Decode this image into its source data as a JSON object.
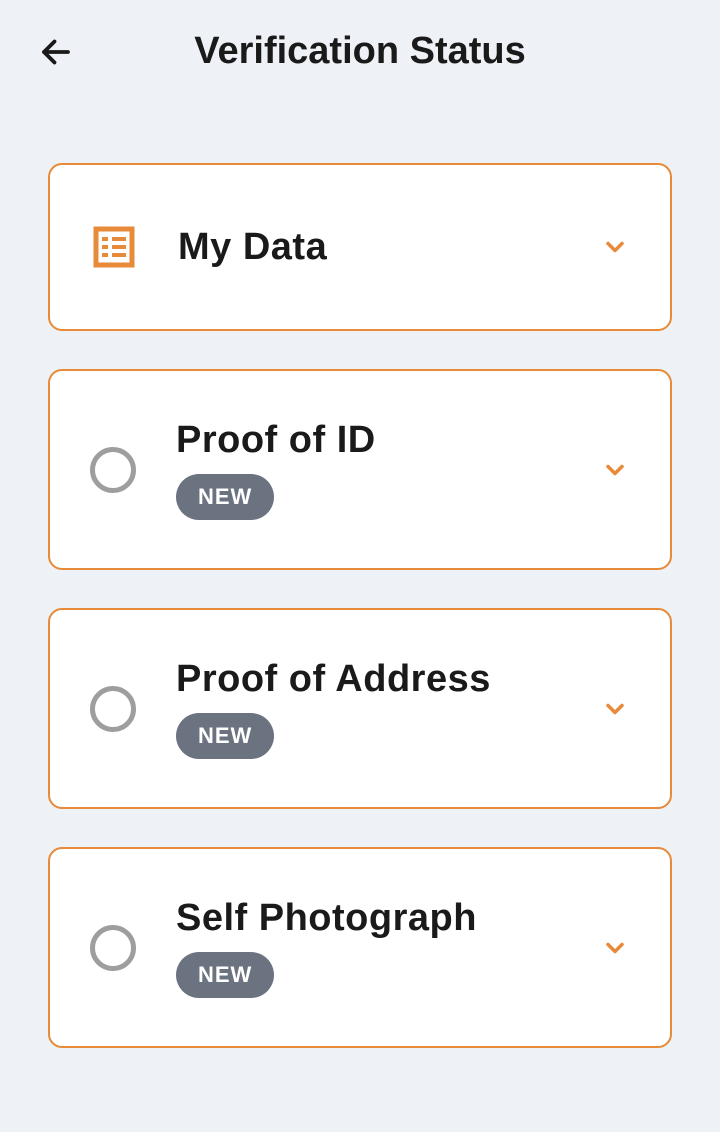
{
  "header": {
    "title": "Verification Status"
  },
  "cards": {
    "myData": {
      "title": "My Data"
    },
    "proofOfId": {
      "title": "Proof of ID",
      "badge": "NEW"
    },
    "proofOfAddress": {
      "title": "Proof of Address",
      "badge": "NEW"
    },
    "selfPhotograph": {
      "title": "Self Photograph",
      "badge": "NEW"
    }
  },
  "colors": {
    "accent": "#e78a3a",
    "badge": "#6b7280"
  }
}
